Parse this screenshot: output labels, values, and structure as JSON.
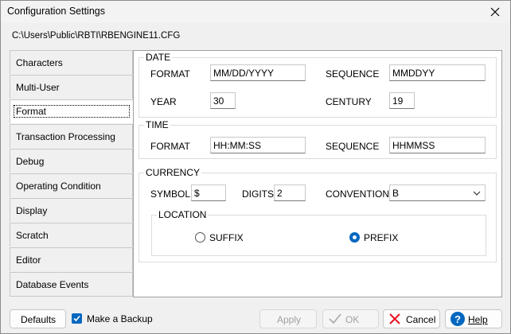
{
  "window": {
    "title": "Configuration Settings",
    "file_path": "C:\\Users\\Public\\RBTI\\RBENGINE11.CFG"
  },
  "tabs": [
    {
      "label": "Characters"
    },
    {
      "label": "Multi-User"
    },
    {
      "label": "Format"
    },
    {
      "label": "Transaction Processing"
    },
    {
      "label": "Debug"
    },
    {
      "label": "Operating Condition"
    },
    {
      "label": "Display"
    },
    {
      "label": "Scratch"
    },
    {
      "label": "Editor"
    },
    {
      "label": "Database Events"
    }
  ],
  "active_tab": "Format",
  "date": {
    "group_label": "DATE",
    "format_label": "FORMAT",
    "format_value": "MM/DD/YYYY",
    "sequence_label": "SEQUENCE",
    "sequence_value": "MMDDYY",
    "year_label": "YEAR",
    "year_value": "30",
    "century_label": "CENTURY",
    "century_value": "19"
  },
  "time": {
    "group_label": "TIME",
    "format_label": "FORMAT",
    "format_value": "HH:MM:SS",
    "sequence_label": "SEQUENCE",
    "sequence_value": "HHMMSS"
  },
  "currency": {
    "group_label": "CURRENCY",
    "symbol_label": "SYMBOL",
    "symbol_value": "$",
    "digits_label": "DIGITS",
    "digits_value": "2",
    "convention_label": "CONVENTION",
    "convention_value": "B",
    "location": {
      "group_label": "LOCATION",
      "suffix_label": "SUFFIX",
      "suffix_checked": false,
      "prefix_label": "PREFIX",
      "prefix_checked": true
    }
  },
  "footer": {
    "defaults_label": "Defaults",
    "backup_label": "Make a Backup",
    "backup_checked": true,
    "apply_label": "Apply",
    "ok_label": "OK",
    "cancel_label": "Cancel",
    "help_label": "Help"
  },
  "colors": {
    "accent": "#0067c0",
    "cancel_icon": "#e81123",
    "ok_icon": "#a0a0a0"
  }
}
